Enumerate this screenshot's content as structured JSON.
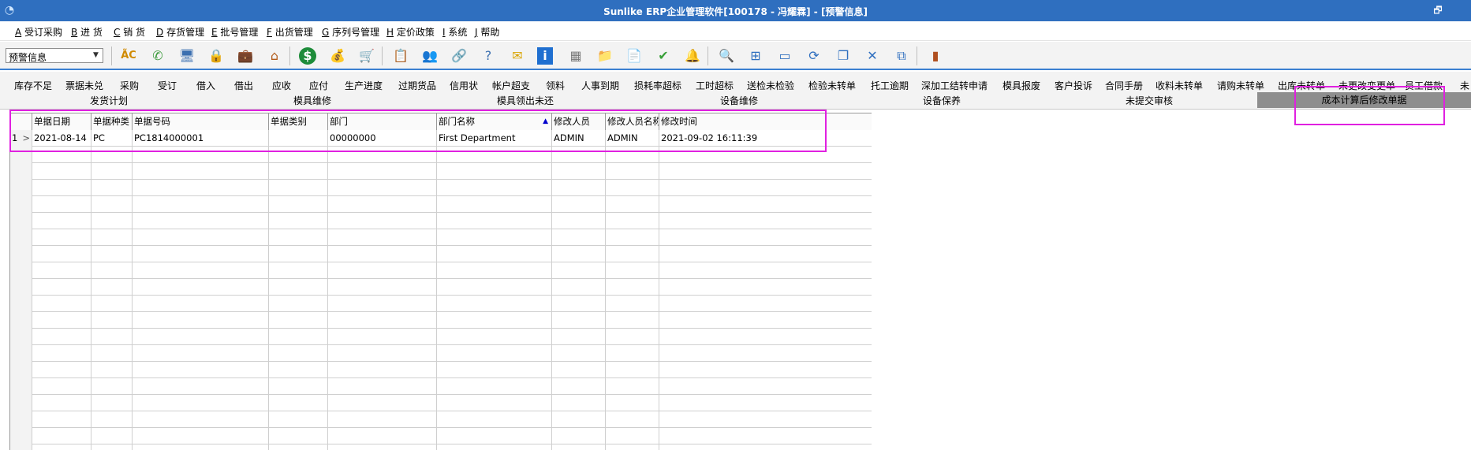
{
  "window": {
    "title": "Sunlike ERP企业管理软件[100178 - 冯耀霖] - [预警信息]",
    "restore_glyph": "🗗"
  },
  "menu": [
    {
      "key": "A",
      "label": " 受订采购"
    },
    {
      "key": "B",
      "label": " 进 货"
    },
    {
      "key": "C",
      "label": " 销 货"
    },
    {
      "key": "D",
      "label": " 存货管理"
    },
    {
      "key": "E",
      "label": " 批号管理"
    },
    {
      "key": "F",
      "label": " 出货管理"
    },
    {
      "key": "G",
      "label": " 序列号管理"
    },
    {
      "key": "H",
      "label": " 定价政策"
    },
    {
      "key": "I",
      "label": " 系统"
    },
    {
      "key": "J",
      "label": " 帮助"
    }
  ],
  "toolbar": {
    "combo_value": "预警信息",
    "icons": [
      "spellcheck-icon",
      "phone-icon",
      "computer-icon",
      "lock-icon",
      "briefcase-icon",
      "home-icon",
      "dollar-icon",
      "money-bag-icon",
      "cart-icon",
      "clipboard-icon",
      "users-icon",
      "link-icon",
      "help-doc-icon",
      "mail-icon",
      "info-icon",
      "calculator-icon",
      "folder-icon",
      "documents-icon",
      "check-icon",
      "bell-icon",
      "search-icon",
      "org-chart-icon",
      "monitor-icon",
      "refresh-icon",
      "windows-icon",
      "close-icon",
      "window-swap-icon",
      "exit-door-icon"
    ]
  },
  "tabs_row1": [
    "库存不足",
    "票据未兑",
    "采购",
    "受订",
    "借入",
    "借出",
    "应收",
    "应付",
    "生产进度",
    "过期货品",
    "信用状",
    "帐户超支",
    "领料",
    "人事到期",
    "损耗率超标",
    "工时超标",
    "送检未检验",
    "检验未转单",
    "托工逾期",
    "深加工结转申请",
    "模具报废",
    "客户投诉",
    "合同手册",
    "收料未转单",
    "请购未转单",
    "出库未转单",
    "未更改变更单",
    "员工借款",
    "未"
  ],
  "tabs_row2": [
    "发货计划",
    "模具维修",
    "模具领出未还",
    "设备维修",
    "设备保养",
    "未提交审核",
    "成本计算后修改单据"
  ],
  "grid": {
    "columns": [
      "单据日期",
      "单据种类",
      "单据号码",
      "单据类别",
      "部门",
      "部门名称",
      "修改人员",
      "修改人员名称",
      "修改时间"
    ],
    "sort_column_index": 5,
    "rows": [
      {
        "num": "1",
        "marker": ">",
        "cells": [
          "2021-08-14",
          "PC",
          "PC1814000001",
          "",
          "00000000",
          "First Department",
          "ADMIN",
          "ADMIN",
          "2021-09-02 16:11:39"
        ]
      }
    ],
    "empty_rows": 19
  }
}
